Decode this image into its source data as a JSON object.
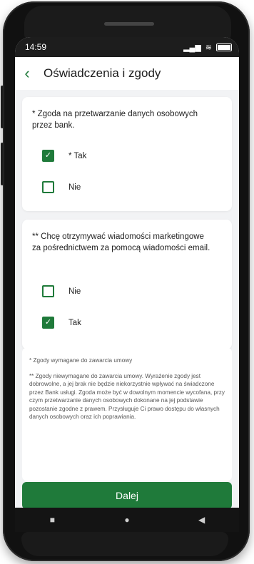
{
  "status": {
    "time": "14:59"
  },
  "header": {
    "title": "Oświadczenia i zgody",
    "back_icon": "chevron-left-icon"
  },
  "cards": [
    {
      "question": "* Zgoda na przetwarzanie danych osobowych przez bank.",
      "options": [
        {
          "label": "* Tak",
          "checked": true
        },
        {
          "label": "Nie",
          "checked": false
        }
      ]
    },
    {
      "question": "** Chcę otrzymywać wiadomości marketingowe za pośrednictwem za pomocą wiadomości email.",
      "options": [
        {
          "label": "Nie",
          "checked": false
        },
        {
          "label": "Tak",
          "checked": true
        }
      ]
    }
  ],
  "info": {
    "line1": "* Zgody wymagane do zawarcia umowy",
    "line2": "** Zgody niewymagane do zawarcia umowy. Wyrażenie zgody jest dobrowolne, a jej brak nie będzie niekorzystnie wpływać na świadczone przez Bank usługi. Zgoda może być w dowolnym momencie wycofana, przy czym przetwarzanie danych osobowych dokonane na jej podstawie pozostanie zgodne z prawem. Przysługuje Ci prawo dostępu do własnych danych osobowych oraz ich poprawiania."
  },
  "actions": {
    "next_label": "Dalej"
  },
  "colors": {
    "accent": "#1f7a3a",
    "background": "#f2f3f5"
  },
  "navbar": {
    "items": [
      "recent-apps-icon",
      "home-icon",
      "back-icon"
    ]
  }
}
